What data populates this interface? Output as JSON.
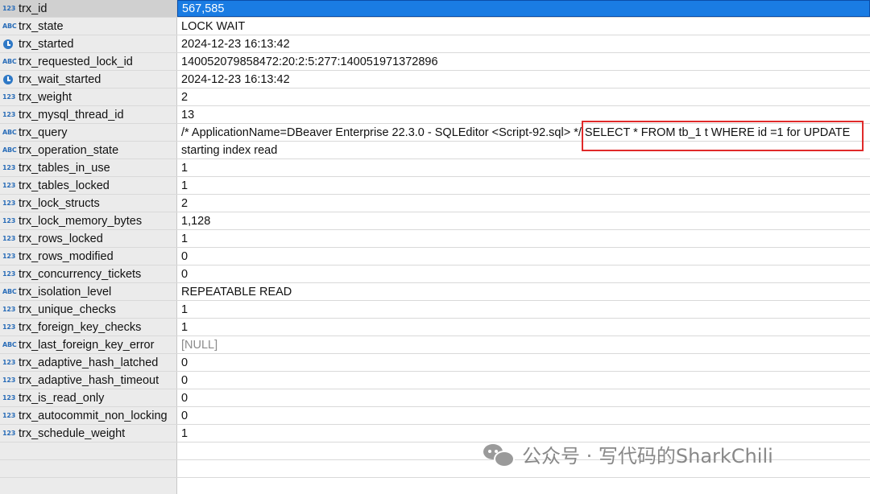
{
  "rows": [
    {
      "type": "123",
      "name": "trx_id",
      "value": "567,585",
      "selected": true
    },
    {
      "type": "ABC",
      "name": "trx_state",
      "value": "LOCK WAIT"
    },
    {
      "type": "clock",
      "name": "trx_started",
      "value": "2024-12-23 16:13:42"
    },
    {
      "type": "ABC",
      "name": "trx_requested_lock_id",
      "value": "140052079858472:20:2:5:277:140051971372896"
    },
    {
      "type": "clock",
      "name": "trx_wait_started",
      "value": "2024-12-23 16:13:42"
    },
    {
      "type": "123",
      "name": "trx_weight",
      "value": "2"
    },
    {
      "type": "123",
      "name": "trx_mysql_thread_id",
      "value": "13"
    },
    {
      "type": "ABC",
      "name": "trx_query",
      "value": "/* ApplicationName=DBeaver Enterprise 22.3.0 - SQLEditor <Script-92.sql> */ SELECT * FROM  tb_1 t WHERE id =1 for UPDATE",
      "highlighted": true
    },
    {
      "type": "ABC",
      "name": "trx_operation_state",
      "value": "starting index read"
    },
    {
      "type": "123",
      "name": "trx_tables_in_use",
      "value": "1"
    },
    {
      "type": "123",
      "name": "trx_tables_locked",
      "value": "1"
    },
    {
      "type": "123",
      "name": "trx_lock_structs",
      "value": "2"
    },
    {
      "type": "123",
      "name": "trx_lock_memory_bytes",
      "value": "1,128"
    },
    {
      "type": "123",
      "name": "trx_rows_locked",
      "value": "1"
    },
    {
      "type": "123",
      "name": "trx_rows_modified",
      "value": "0"
    },
    {
      "type": "123",
      "name": "trx_concurrency_tickets",
      "value": "0"
    },
    {
      "type": "ABC",
      "name": "trx_isolation_level",
      "value": "REPEATABLE READ"
    },
    {
      "type": "123",
      "name": "trx_unique_checks",
      "value": "1"
    },
    {
      "type": "123",
      "name": "trx_foreign_key_checks",
      "value": "1"
    },
    {
      "type": "ABC",
      "name": "trx_last_foreign_key_error",
      "value": "[NULL]",
      "is_null": true
    },
    {
      "type": "123",
      "name": "trx_adaptive_hash_latched",
      "value": "0"
    },
    {
      "type": "123",
      "name": "trx_adaptive_hash_timeout",
      "value": "0"
    },
    {
      "type": "123",
      "name": "trx_is_read_only",
      "value": "0"
    },
    {
      "type": "123",
      "name": "trx_autocommit_non_locking",
      "value": "0"
    },
    {
      "type": "123",
      "name": "trx_schedule_weight",
      "value": "1"
    }
  ],
  "empty_rows": 2,
  "watermark": {
    "text": "公众号 · 写代码的SharkChili",
    "icon": "wechat-icon"
  },
  "colors": {
    "selection": "#1a7ce3",
    "highlight_border": "#e02a2a",
    "null_text": "#8a8a8a"
  }
}
